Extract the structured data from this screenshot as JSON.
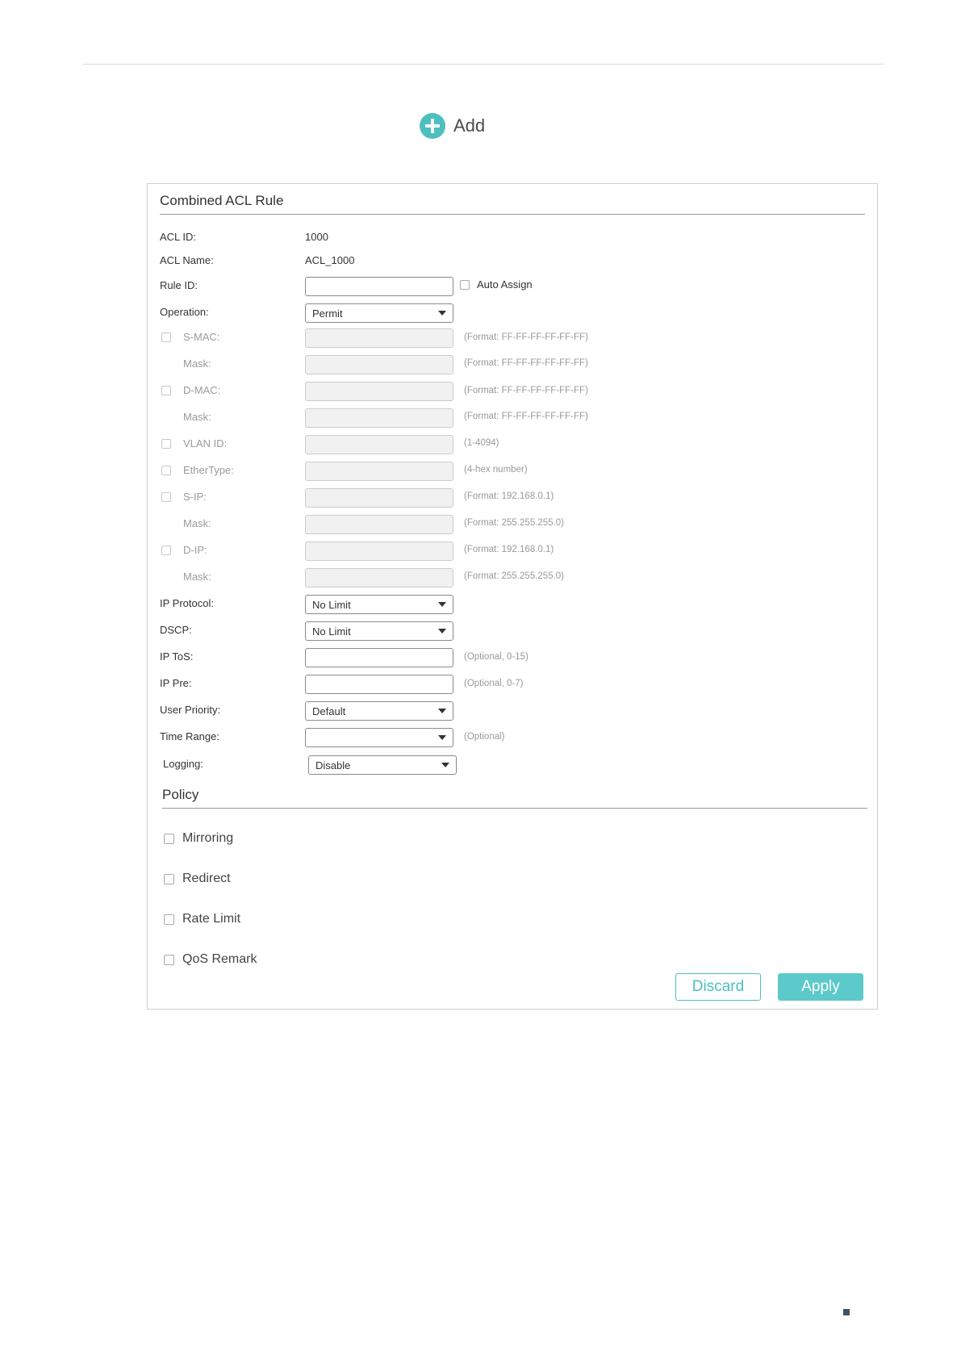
{
  "toolbar": {
    "add_label": "Add"
  },
  "form": {
    "title": "Combined ACL Rule",
    "acl_id": {
      "label": "ACL ID:",
      "value": "1000"
    },
    "acl_name": {
      "label": "ACL Name:",
      "value": "ACL_1000"
    },
    "rule_id": {
      "label": "Rule ID:",
      "value": "",
      "auto_assign_label": "Auto Assign"
    },
    "operation": {
      "label": "Operation:",
      "value": "Permit"
    },
    "s_mac": {
      "label": "S-MAC:",
      "hint": "(Format: FF-FF-FF-FF-FF-FF)"
    },
    "s_mac_mask": {
      "label": "Mask:",
      "hint": "(Format: FF-FF-FF-FF-FF-FF)"
    },
    "d_mac": {
      "label": "D-MAC:",
      "hint": "(Format: FF-FF-FF-FF-FF-FF)"
    },
    "d_mac_mask": {
      "label": "Mask:",
      "hint": "(Format: FF-FF-FF-FF-FF-FF)"
    },
    "vlan_id": {
      "label": "VLAN ID:",
      "hint": "(1-4094)"
    },
    "ethertype": {
      "label": "EtherType:",
      "hint": "(4-hex number)"
    },
    "s_ip": {
      "label": "S-IP:",
      "hint": "(Format: 192.168.0.1)"
    },
    "s_ip_mask": {
      "label": "Mask:",
      "hint": "(Format: 255.255.255.0)"
    },
    "d_ip": {
      "label": "D-IP:",
      "hint": "(Format: 192.168.0.1)"
    },
    "d_ip_mask": {
      "label": "Mask:",
      "hint": "(Format: 255.255.255.0)"
    },
    "ip_protocol": {
      "label": "IP Protocol:",
      "value": "No Limit"
    },
    "dscp": {
      "label": "DSCP:",
      "value": "No Limit"
    },
    "ip_tos": {
      "label": "IP ToS:",
      "value": "",
      "hint": "(Optional, 0-15)"
    },
    "ip_pre": {
      "label": "IP Pre:",
      "value": "",
      "hint": "(Optional, 0-7)"
    },
    "user_priority": {
      "label": "User Priority:",
      "value": "Default"
    },
    "time_range": {
      "label": "Time Range:",
      "value": "",
      "hint": "(Optional)"
    },
    "logging": {
      "label": "Logging:",
      "value": "Disable"
    }
  },
  "policy": {
    "title": "Policy",
    "items": [
      "Mirroring",
      "Redirect",
      "Rate Limit",
      "QoS Remark"
    ]
  },
  "actions": {
    "discard_label": "Discard",
    "apply_label": "Apply"
  },
  "colors": {
    "accent": "#4dbfbf",
    "apply_bg": "#5ccaca",
    "disabled_field_bg": "#f1f1f1"
  }
}
